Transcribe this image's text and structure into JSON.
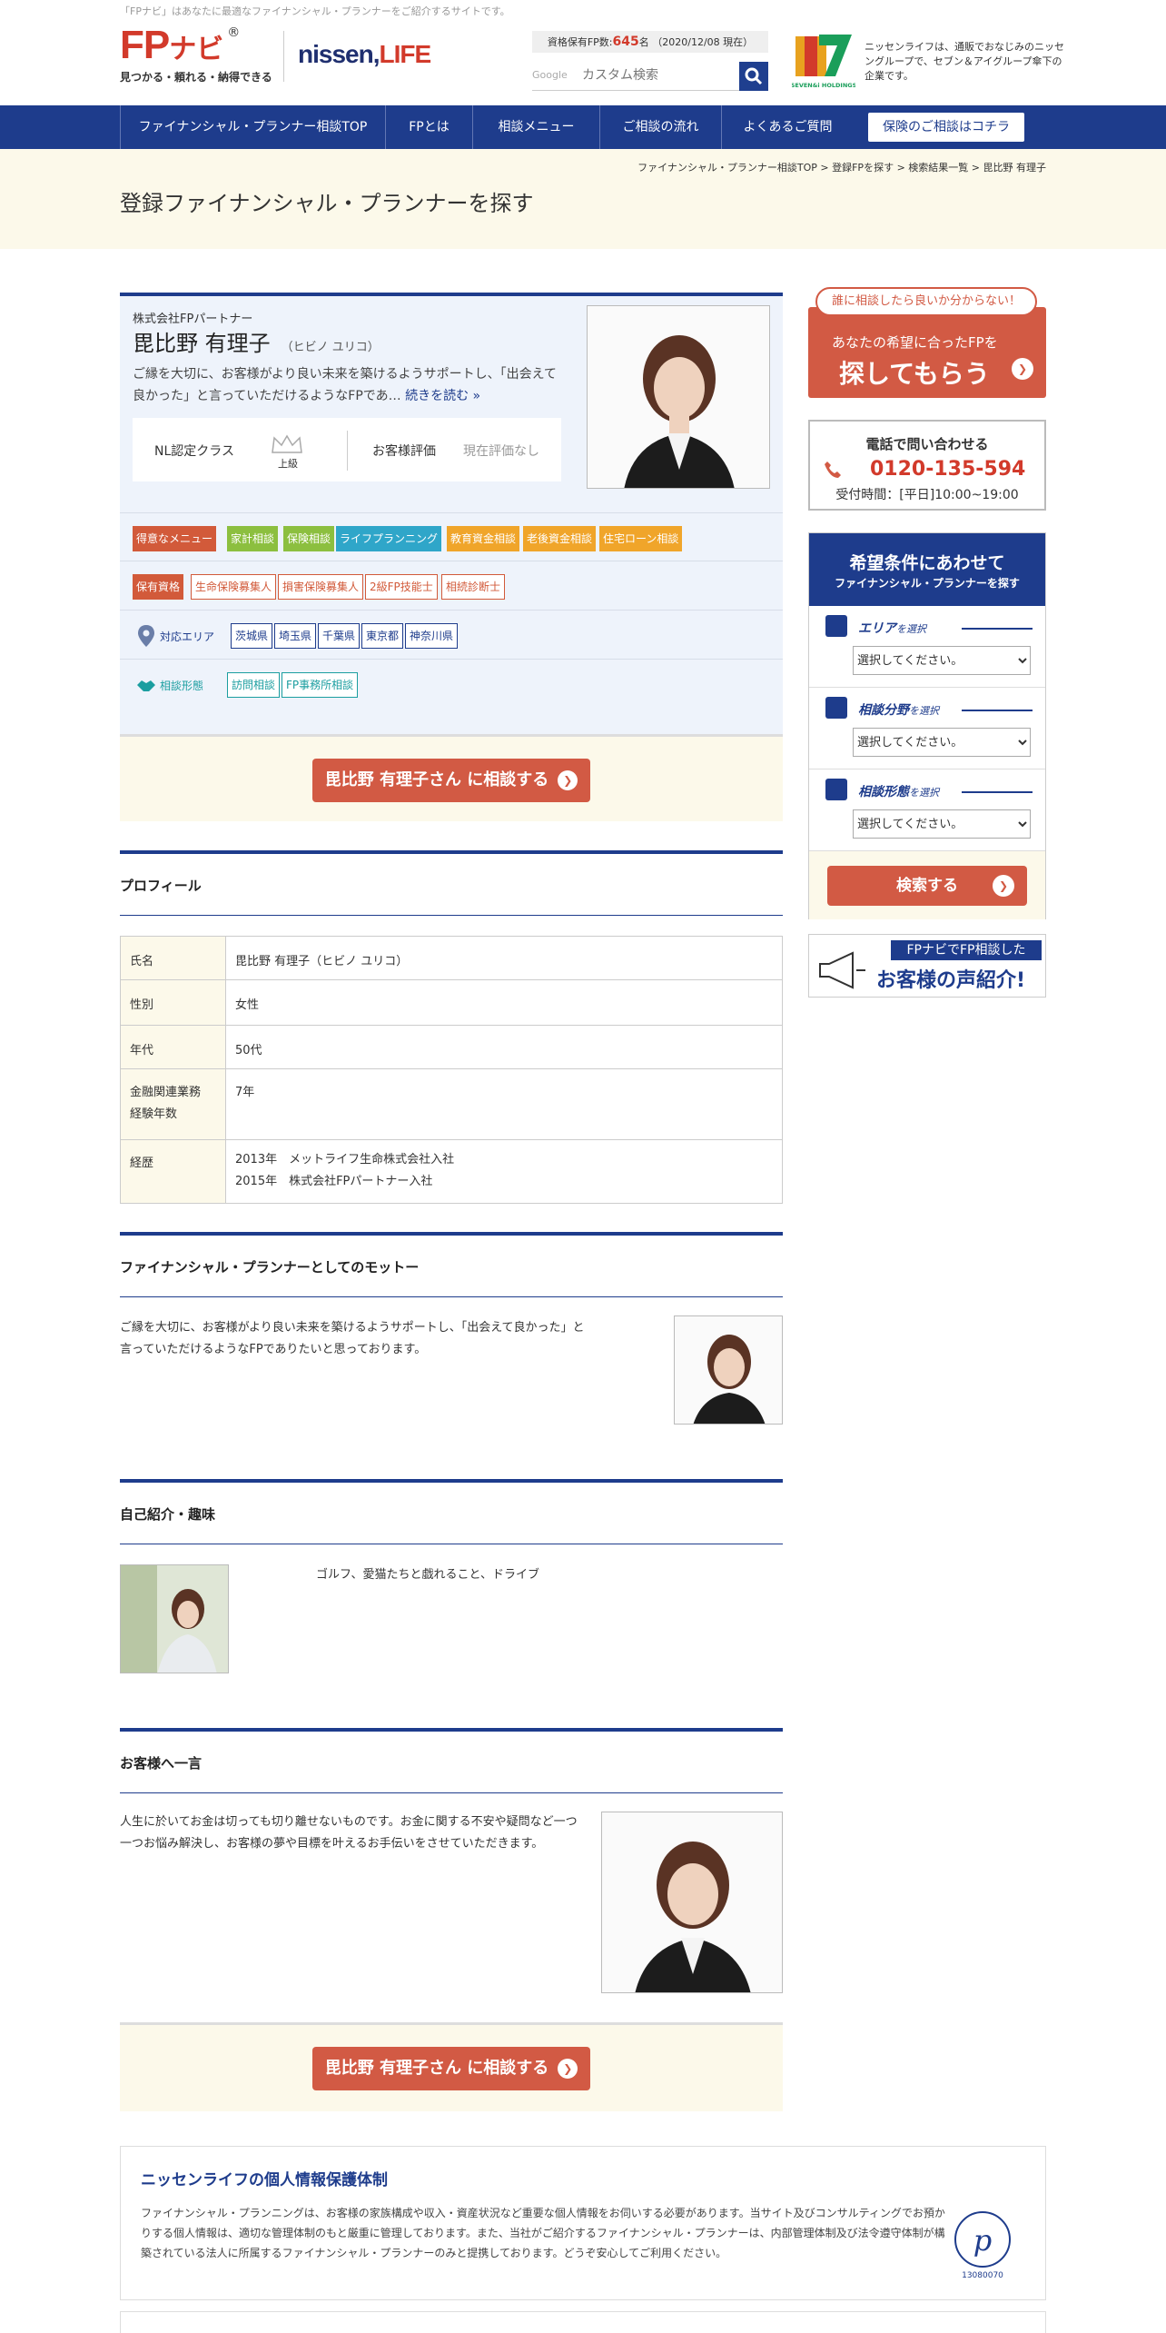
{
  "header": {
    "tagline": "「FPナビ」はあなたに最適なファイナンシャル・プランナーをご紹介するサイトです。",
    "logo_fp": "FP",
    "logo_navi": "ナビ",
    "logo_reg": "®",
    "logo_sub": "見つかる・頼れる・納得できる",
    "nissen_a": "nissen,",
    "nissen_b": "LIFE",
    "count_prefix": "資格保有FP数:",
    "count_value": "645",
    "count_suffix": "名 （2020/12/08 現在）",
    "search_brand": "Google",
    "search_placeholder": "カスタム検索",
    "seven_label": "SEVEN&i HOLDINGS",
    "seven_text": "ニッセンライフは、通販でおなじみのニッセングループで、セブン＆アイグループ傘下の企業です。"
  },
  "nav": {
    "items": [
      "ファイナンシャル・プランナー相談TOP",
      "FPとは",
      "相談メニュー",
      "ご相談の流れ",
      "よくあるご質問"
    ],
    "cta": "保険のご相談はコチラ"
  },
  "breadcrumb": "ファイナンシャル・プランナー相談TOP > 登録FPを探す > 検索結果一覧 > 毘比野 有理子",
  "page_title": "登録ファイナンシャル・プランナーを探す",
  "fp": {
    "company": "株式会社FPパートナー",
    "name": "毘比野 有理子",
    "kana": "（ヒビノ ユリコ）",
    "intro": "ご縁を大切に、お客様がより良い未来を築けるようサポートし、「出会えて良かった」と言っていただけるようなFPであ…",
    "read_more": "続きを読む »",
    "rank_label": "NL認定クラス",
    "rank_value": "上級",
    "review_label": "お客様評価",
    "review_value": "現在評価なし",
    "menu_label": "得意なメニュー",
    "menus": [
      "家計相談",
      "保険相談",
      "ライフプランニング",
      "教育資金相談",
      "老後資金相談",
      "住宅ローン相談"
    ],
    "qual_label": "保有資格",
    "quals": [
      "生命保険募集人",
      "損害保険募集人",
      "2級FP技能士",
      "相続診断士"
    ],
    "area_label": "対応エリア",
    "areas": [
      "茨城県",
      "埼玉県",
      "千葉県",
      "東京都",
      "神奈川県"
    ],
    "style_label": "相談形態",
    "styles": [
      "訪問相談",
      "FP事務所相談"
    ],
    "cta": "毘比野 有理子さん に相談する"
  },
  "colors": {
    "menu_tags": [
      "#8cbf3f",
      "#8cbf3f",
      "#2fa6c9",
      "#f0a52a",
      "#f0a52a",
      "#f0a52a"
    ]
  },
  "profile": {
    "heading": "プロフィール",
    "rows": [
      {
        "k": "氏名",
        "v": "毘比野 有理子（ヒビノ ユリコ）"
      },
      {
        "k": "性別",
        "v": "女性"
      },
      {
        "k": "年代",
        "v": "50代"
      },
      {
        "k1": "金融関連業務",
        "k2": "経験年数",
        "v": "7年"
      },
      {
        "k": "経歴",
        "v1": "2013年　メットライフ生命株式会社入社",
        "v2": "2015年　株式会社FPパートナー入社"
      }
    ]
  },
  "motto": {
    "heading": "ファイナンシャル・プランナーとしてのモットー",
    "text": "ご縁を大切に、お客様がより良い未来を築けるようサポートし、「出会えて良かった」と言っていただけるようなFPでありたいと思っております。"
  },
  "hobby": {
    "heading": "自己紹介・趣味",
    "text": "ゴルフ、愛猫たちと戯れること、ドライブ"
  },
  "message": {
    "heading": "お客様へ一言",
    "text": "人生に於いてお金は切っても切り離せないものです。お金に関する不安や疑問など一つ一つお悩み解決し、お客様の夢や目標を叶えるお手伝いをさせていただきます。"
  },
  "privacy": {
    "heading": "ニッセンライフの個人情報保護体制",
    "text": "ファイナンシャル・プランニングは、お客様の家族構成や収入・資産状況など重要な個人情報をお伺いする必要があります。当サイト及びコンサルティングでお預かりする個人情報は、適切な管理体制のもと厳重に管理しております。また、当社がご紹介するファイナンシャル・プランナーは、内部管理体制及び法令遵守体制が構築されている法人に所属するファイナンシャル・プランナーのみと提携しております。どうぞ安心してご利用ください。",
    "pmark_id": "13080070"
  },
  "sidebar": {
    "bubble": "誰に相談したら良いか分からない！",
    "red_a": "あなたの希望に合ったFPを",
    "red_b": "探してもらう",
    "tel_h": "電話で問い合わせる",
    "tel_n": "0120-135-594",
    "tel_t": "受付時間：[平日]10:00~19:00",
    "cond_a": "希望条件にあわせて",
    "cond_b": "ファイナンシャル・プランナーを探す",
    "area_l": "エリア",
    "field_l": "相談分野",
    "style_l": "相談形態",
    "select_suffix": "を選択",
    "select_default": "選択してください。",
    "search_btn": "検索する",
    "voice_a": "FPナビでFP相談した",
    "voice_b": "お客様の声紹介!"
  }
}
